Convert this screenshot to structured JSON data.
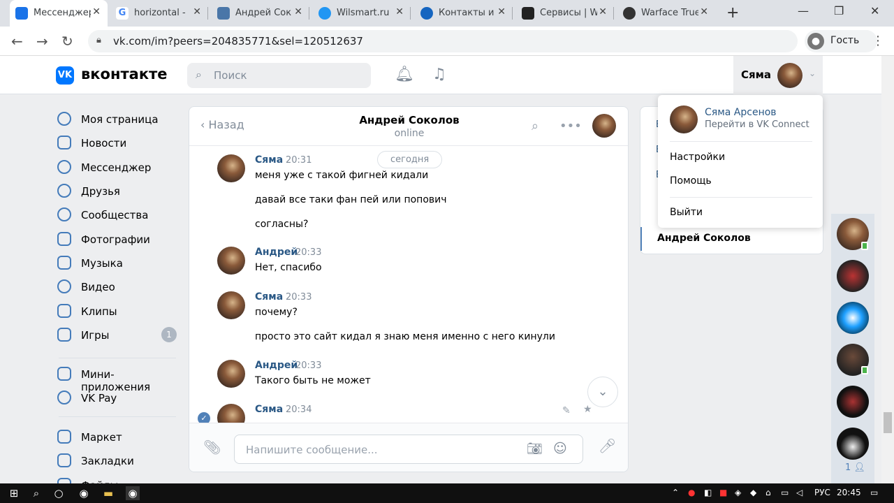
{
  "browser": {
    "tabs": [
      {
        "label": "Мессенджер",
        "icon": "vk-messenger-icon",
        "color": "#1a73e8",
        "active": true
      },
      {
        "label": "horizontal -",
        "icon": "google-icon",
        "color": "#4285f4"
      },
      {
        "label": "Андрей Сок",
        "icon": "vk-icon",
        "color": "#4a76a8"
      },
      {
        "label": "Wilsmart.ru",
        "icon": "link-icon",
        "color": "#2196f3"
      },
      {
        "label": "Контакты и",
        "icon": "at-icon",
        "color": "#1565c0"
      },
      {
        "label": "Сервисы | W",
        "icon": "bars-icon",
        "color": "#222222"
      },
      {
        "label": "Warface True",
        "icon": "eye-icon",
        "color": "#333333"
      }
    ],
    "new_tab": "+",
    "url": "vk.com/im?peers=204835771&sel=120512637",
    "guest_label": "Гость"
  },
  "header": {
    "logo_text": "вконтакте",
    "logo_mark": "VK",
    "search_placeholder": "Поиск",
    "profile_name": "Сяма"
  },
  "sidebar": {
    "items": [
      {
        "label": "Моя страница"
      },
      {
        "label": "Новости"
      },
      {
        "label": "Мессенджер"
      },
      {
        "label": "Друзья"
      },
      {
        "label": "Сообщества"
      },
      {
        "label": "Фотографии"
      },
      {
        "label": "Музыка"
      },
      {
        "label": "Видео"
      },
      {
        "label": "Клипы"
      },
      {
        "label": "Игры",
        "badge": "1"
      },
      {
        "label": "Мини-приложения"
      },
      {
        "label": "VK Pay"
      },
      {
        "label": "Маркет"
      },
      {
        "label": "Закладки"
      },
      {
        "label": "Файлы"
      }
    ]
  },
  "chat": {
    "back_label": "Назад",
    "name": "Андрей Соколов",
    "status": "online",
    "date_label": "сегодня",
    "messages": [
      {
        "author": "Сяма",
        "time": "20:31",
        "lines": [
          "меня уже с такой фигней кидали",
          "давай все таки фан пей или попович",
          "согласны?"
        ]
      },
      {
        "author": "Андрей",
        "time": "20:33",
        "lines": [
          "Нет, спасибо"
        ]
      },
      {
        "author": "Сяма",
        "time": "20:33",
        "lines": [
          "почему?",
          "просто это сайт кидал я знаю меня именно с него кинули"
        ]
      },
      {
        "author": "Андрей",
        "time": "20:33",
        "lines": [
          "Такого быть не может"
        ]
      },
      {
        "author": "Сяма",
        "time": "20:34",
        "lines": []
      }
    ],
    "input_placeholder": "Напишите сообщение..."
  },
  "right_panel": {
    "selected": "Андрей Соколов"
  },
  "profile_menu": {
    "name": "Сяма Арсенов",
    "connect": "Перейти в VK Connect",
    "settings": "Настройки",
    "help": "Помощь",
    "logout": "Выйти"
  },
  "friends_bar": {
    "count": "1"
  },
  "taskbar": {
    "lang": "РУС",
    "time": "20:45"
  }
}
